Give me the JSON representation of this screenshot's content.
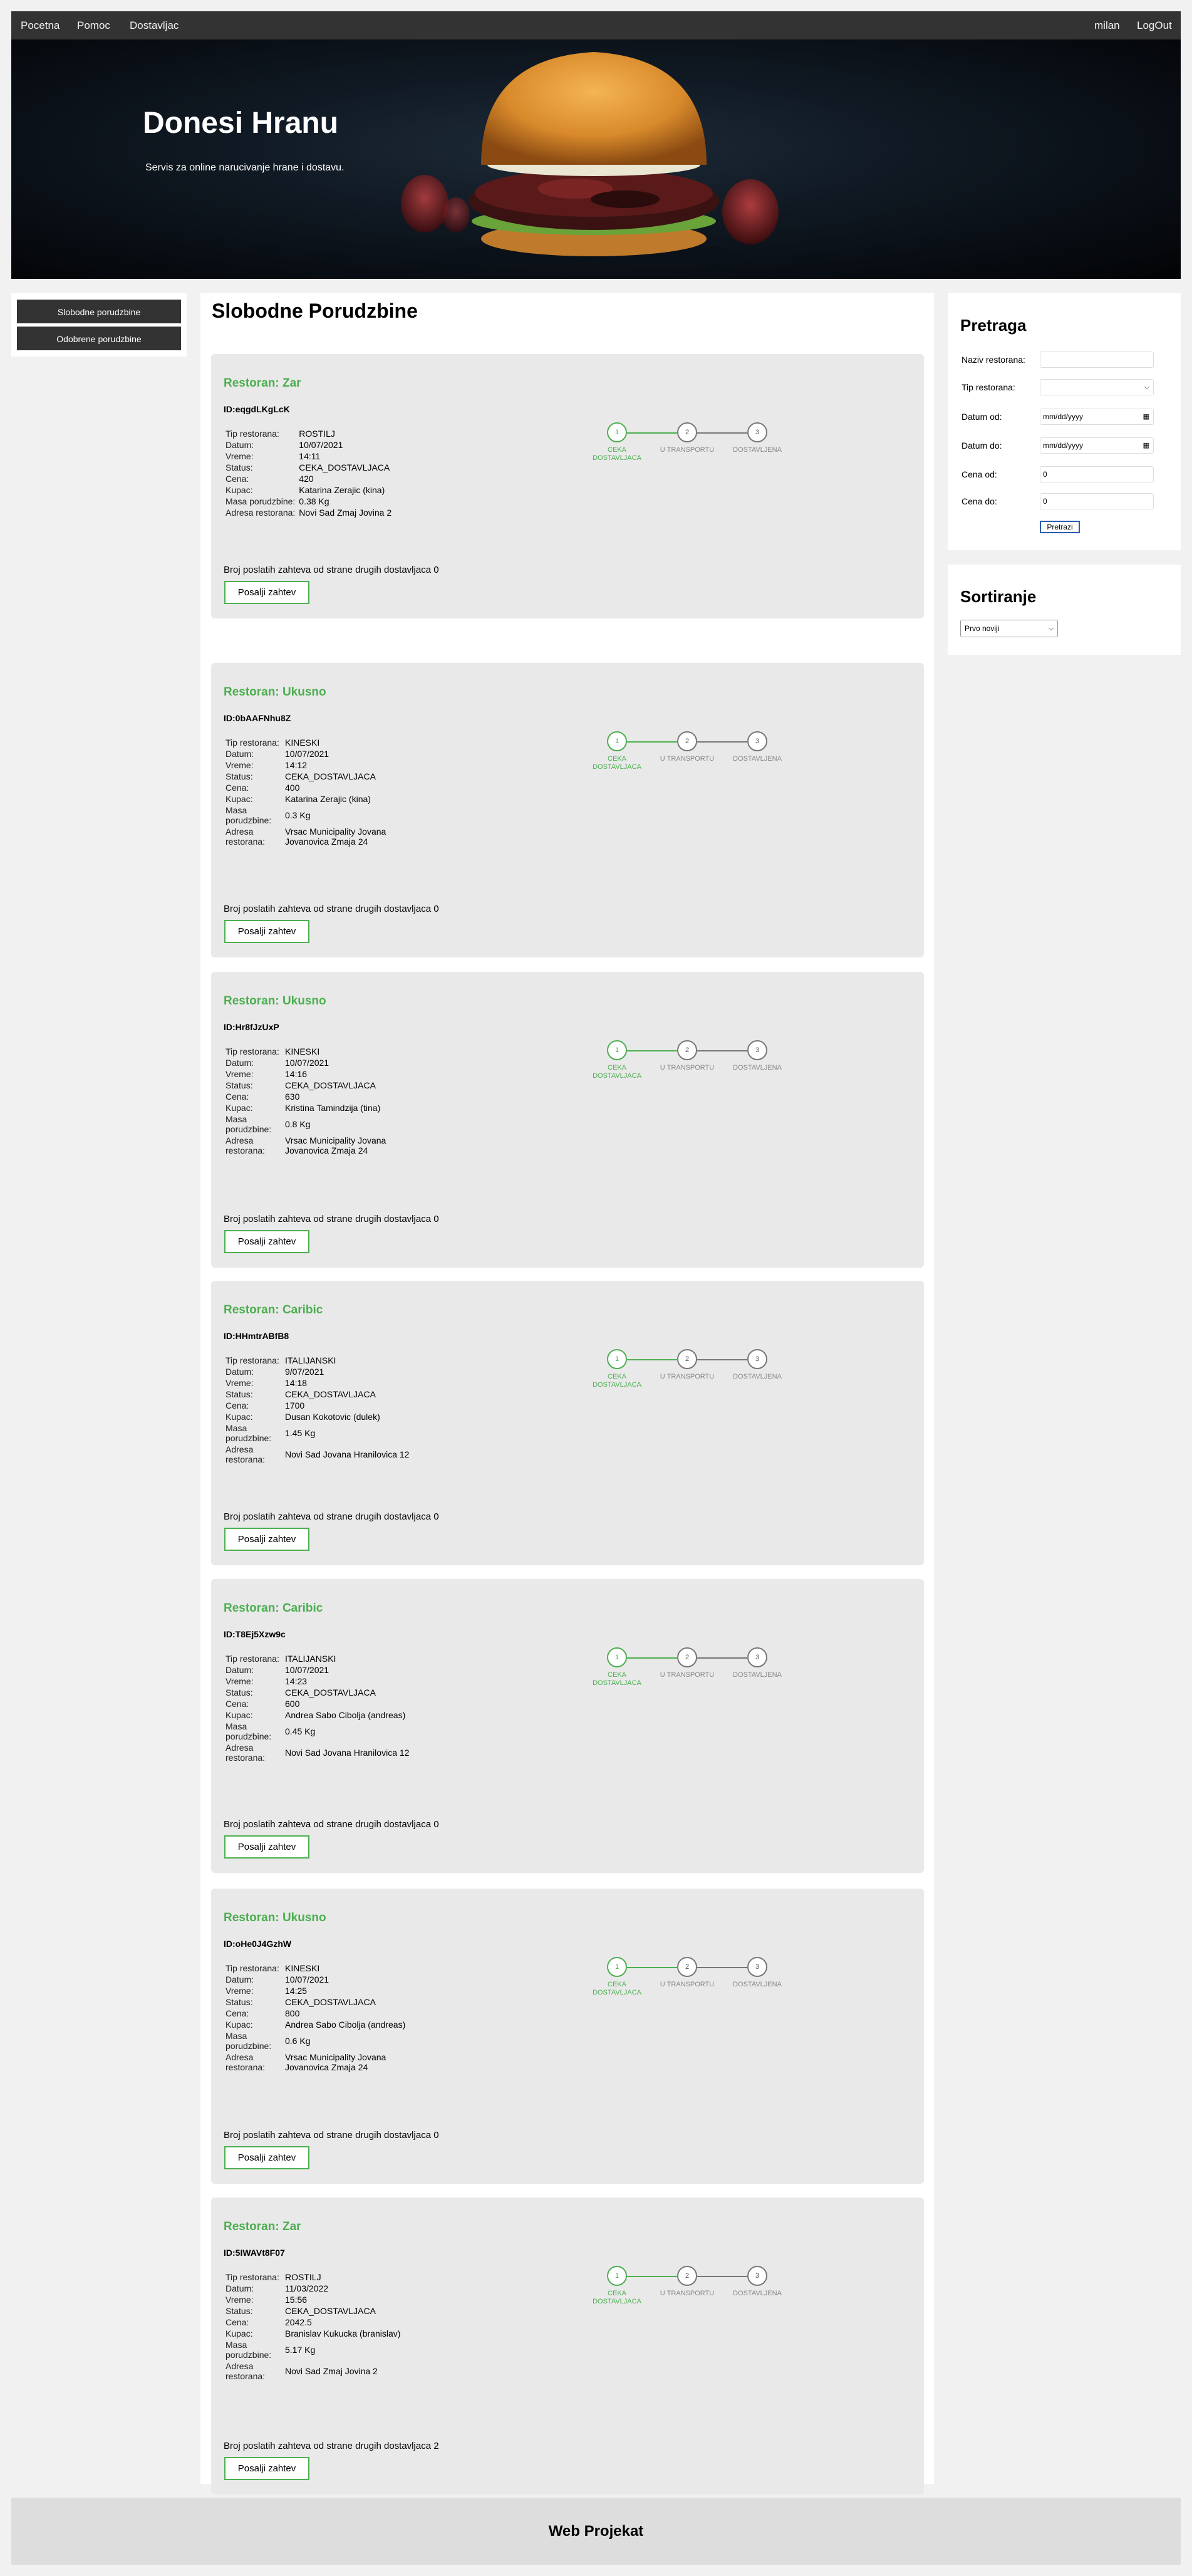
{
  "nav": {
    "left": [
      "Pocetna",
      "Pomoc",
      "Dostavljac"
    ],
    "user": "milan",
    "logout": "LogOut"
  },
  "header": {
    "title": "Donesi Hranu",
    "subtitle": "Servis za online narucivanje hrane i dostavu."
  },
  "side_menu": {
    "items": [
      "Slobodne porudzbine",
      "Odobrene porudzbine"
    ]
  },
  "main": {
    "title": "Slobodne Porudzbine",
    "steps": [
      "CEKA DOSTAVLJACA",
      "U TRANSPORTU",
      "DOSTAVLJENA"
    ],
    "step_numbers": [
      "1",
      "2",
      "3"
    ],
    "labels": {
      "tip": "Tip restorana:",
      "datum": "Datum:",
      "vreme": "Vreme:",
      "status": "Status:",
      "cena": "Cena:",
      "kupac": "Kupac:",
      "masa": "Masa porudzbine:",
      "adresa": "Adresa restorana:"
    },
    "count_prefix": "Broj poslatih zahteva od strane drugih dostavljaca",
    "send_label": "Posalji zahtev",
    "orders": [
      {
        "restaurant": "Restoran: Zar",
        "id": "ID:eqgdLKgLcK",
        "tip": "ROSTILJ",
        "datum": "10/07/2021",
        "vreme": "14:11",
        "status": "CEKA_DOSTAVLJACA",
        "cena": "420",
        "kupac": "Katarina Zerajic (kina)",
        "masa": "0.38 Kg",
        "adresa": "Novi Sad Zmaj Jovina 2",
        "count": "0",
        "current_step": 1
      },
      {
        "restaurant": "Restoran: Ukusno",
        "id": "ID:0bAAFNhu8Z",
        "tip": "KINESKI",
        "datum": "10/07/2021",
        "vreme": "14:12",
        "status": "CEKA_DOSTAVLJACA",
        "cena": "400",
        "kupac": "Katarina Zerajic (kina)",
        "masa": "0.3 Kg",
        "adresa": "Vrsac Municipality Jovana Jovanovica Zmaja 24",
        "count": "0",
        "current_step": 1
      },
      {
        "restaurant": "Restoran: Ukusno",
        "id": "ID:Hr8fJzUxP",
        "tip": "KINESKI",
        "datum": "10/07/2021",
        "vreme": "14:16",
        "status": "CEKA_DOSTAVLJACA",
        "cena": "630",
        "kupac": "Kristina Tamindzija (tina)",
        "masa": "0.8 Kg",
        "adresa": "Vrsac Municipality Jovana Jovanovica Zmaja 24",
        "count": "0",
        "current_step": 1
      },
      {
        "restaurant": "Restoran: Caribic",
        "id": "ID:HHmtrABfB8",
        "tip": "ITALIJANSKI",
        "datum": "9/07/2021",
        "vreme": "14:18",
        "status": "CEKA_DOSTAVLJACA",
        "cena": "1700",
        "kupac": "Dusan Kokotovic (dulek)",
        "masa": "1.45 Kg",
        "adresa": "Novi Sad Jovana Hranilovica 12",
        "count": "0",
        "current_step": 1
      },
      {
        "restaurant": "Restoran: Caribic",
        "id": "ID:T8Ej5Xzw9c",
        "tip": "ITALIJANSKI",
        "datum": "10/07/2021",
        "vreme": "14:23",
        "status": "CEKA_DOSTAVLJACA",
        "cena": "600",
        "kupac": "Andrea Sabo Cibolja (andreas)",
        "masa": "0.45 Kg",
        "adresa": "Novi Sad Jovana Hranilovica 12",
        "count": "0",
        "current_step": 1
      },
      {
        "restaurant": "Restoran: Ukusno",
        "id": "ID:oHe0J4GzhW",
        "tip": "KINESKI",
        "datum": "10/07/2021",
        "vreme": "14:25",
        "status": "CEKA_DOSTAVLJACA",
        "cena": "800",
        "kupac": "Andrea Sabo Cibolja (andreas)",
        "masa": "0.6 Kg",
        "adresa": "Vrsac Municipality Jovana Jovanovica Zmaja 24",
        "count": "0",
        "current_step": 1
      },
      {
        "restaurant": "Restoran: Zar",
        "id": "ID:5IWAVt8F07",
        "tip": "ROSTILJ",
        "datum": "11/03/2022",
        "vreme": "15:56",
        "status": "CEKA_DOSTAVLJACA",
        "cena": "2042.5",
        "kupac": "Branislav Kukucka (branislav)",
        "masa": "5.17 Kg",
        "adresa": "Novi Sad Zmaj Jovina 2",
        "count": "2",
        "current_step": 1
      }
    ]
  },
  "search": {
    "title": "Pretraga",
    "fields": {
      "naziv": {
        "label": "Naziv restorana:",
        "value": ""
      },
      "tip": {
        "label": "Tip restorana:",
        "value": ""
      },
      "datum_od": {
        "label": "Datum od:",
        "value": "mm/dd/yyyy"
      },
      "datum_do": {
        "label": "Datum do:",
        "value": "mm/dd/yyyy"
      },
      "cena_od": {
        "label": "Cena od:",
        "value": "0"
      },
      "cena_do": {
        "label": "Cena do:",
        "value": "0"
      }
    },
    "button": "Pretrazi"
  },
  "sort": {
    "title": "Sortiranje",
    "selected": "Prvo noviji"
  },
  "footer": {
    "text": "Web Projekat"
  },
  "colors": {
    "accent": "#4caf50",
    "nav": "#333333",
    "card": "#e9e9e9"
  }
}
